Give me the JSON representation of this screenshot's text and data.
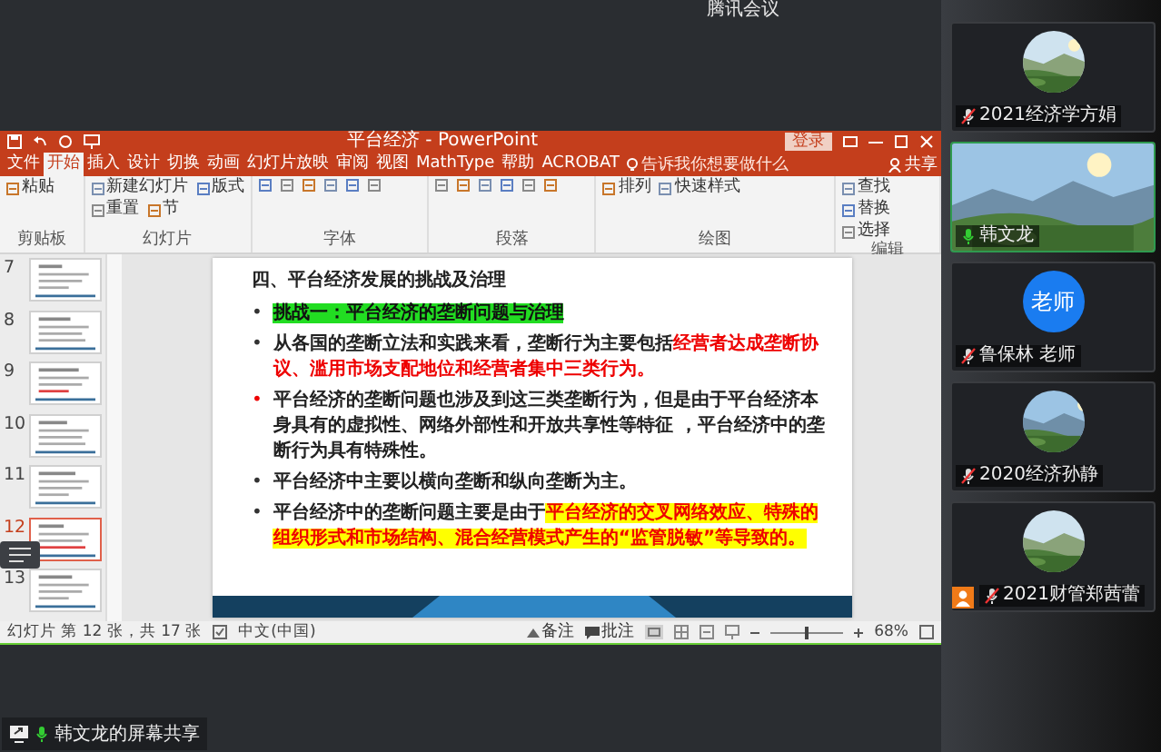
{
  "app_title": "腾讯会议",
  "ppt": {
    "title": "平台经济 - PowerPoint",
    "sign_in": "登录",
    "tabs": [
      {
        "label": "文件",
        "selected": false
      },
      {
        "label": "开始",
        "selected": true
      },
      {
        "label": "插入",
        "selected": false
      },
      {
        "label": "设计",
        "selected": false
      },
      {
        "label": "切换",
        "selected": false
      },
      {
        "label": "动画",
        "selected": false
      },
      {
        "label": "幻灯片放映",
        "selected": false
      },
      {
        "label": "审阅",
        "selected": false
      },
      {
        "label": "视图",
        "selected": false
      },
      {
        "label": "MathType",
        "selected": false
      },
      {
        "label": "帮助",
        "selected": false
      },
      {
        "label": "ACROBAT",
        "selected": false
      }
    ],
    "tell_me": {
      "placeholder": "告诉我你想要做什么"
    },
    "share": "共享",
    "ribbon_groups": [
      {
        "label": "剪贴板",
        "buttons": [
          "粘贴"
        ]
      },
      {
        "label": "幻灯片",
        "buttons": [
          "新建幻灯片",
          "版式",
          "重置",
          "节"
        ]
      },
      {
        "label": "字体"
      },
      {
        "label": "段落"
      },
      {
        "label": "绘图",
        "buttons": [
          "排列",
          "快速样式"
        ]
      },
      {
        "label": "编辑",
        "buttons": [
          "查找",
          "替换",
          "选择"
        ]
      }
    ],
    "thumbnails": [
      {
        "number": "7",
        "selected": false
      },
      {
        "number": "8",
        "selected": false
      },
      {
        "number": "9",
        "selected": false
      },
      {
        "number": "10",
        "selected": false
      },
      {
        "number": "11",
        "selected": false
      },
      {
        "number": "12",
        "selected": true
      },
      {
        "number": "13",
        "selected": false
      }
    ],
    "slide": {
      "title": "四、平台经济发展的挑战及治理",
      "bullets": [
        {
          "marker": "•",
          "color": "#333333",
          "segments": [
            {
              "kind": "green_highlight",
              "text": "挑战一：平台经济的垄断问题与治理"
            }
          ]
        },
        {
          "marker": "•",
          "color": "#333333",
          "segments": [
            {
              "kind": "plain",
              "text": "从各国的垄断立法和实践来看，垄断行为主要包括"
            },
            {
              "kind": "red",
              "text": "经营者达成垄断协议、滥用市场支配地位和经营者集中三类行为。"
            }
          ]
        },
        {
          "marker": "•",
          "color": "#ee0000",
          "segments": [
            {
              "kind": "plain",
              "text": "平台经济的垄断问题也涉及到这三类垄断行为，但是由于平台经济本身具有的虚拟性、网络外部性和开放共享性等特征 ，平台经济中的垄断行为具有特殊性。"
            }
          ]
        },
        {
          "marker": "•",
          "color": "#333333",
          "segments": [
            {
              "kind": "plain",
              "text": "平台经济中主要以横向垄断和纵向垄断为主。"
            }
          ]
        },
        {
          "marker": "•",
          "color": "#333333",
          "segments": [
            {
              "kind": "plain",
              "text": "平台经济中的垄断问题主要是由于"
            },
            {
              "kind": "red_on_yellow",
              "text": "平台经济的交叉网络效应、特殊的组织形式和市场结构、混合经营模式产生的“监管脱敏”等导致的。"
            }
          ]
        }
      ]
    },
    "status": {
      "slide_info": "幻灯片 第 12 张，共 17 张",
      "language": "中文(中国)",
      "notes": "备注",
      "comments": "批注",
      "zoom": {
        "level": 0.5
      },
      "zoom_reading": "68%"
    }
  },
  "share_label": "韩文龙的屏幕共享",
  "participants": [
    {
      "name": "2021经济学方娟",
      "kind": "picture",
      "muted": true,
      "speaking": false,
      "host": false
    },
    {
      "name": "韩文龙",
      "kind": "video",
      "muted": false,
      "speaking": true,
      "host": false
    },
    {
      "name": "鲁保林 老师",
      "kind": "text",
      "avatar_text": "老师",
      "muted": true,
      "speaking": false,
      "host": false
    },
    {
      "name": "2020经济孙静",
      "kind": "picture",
      "muted": true,
      "speaking": false,
      "host": false
    },
    {
      "name": "2021财管郑茜蕾",
      "kind": "picture",
      "muted": true,
      "speaking": false,
      "host": true
    }
  ]
}
